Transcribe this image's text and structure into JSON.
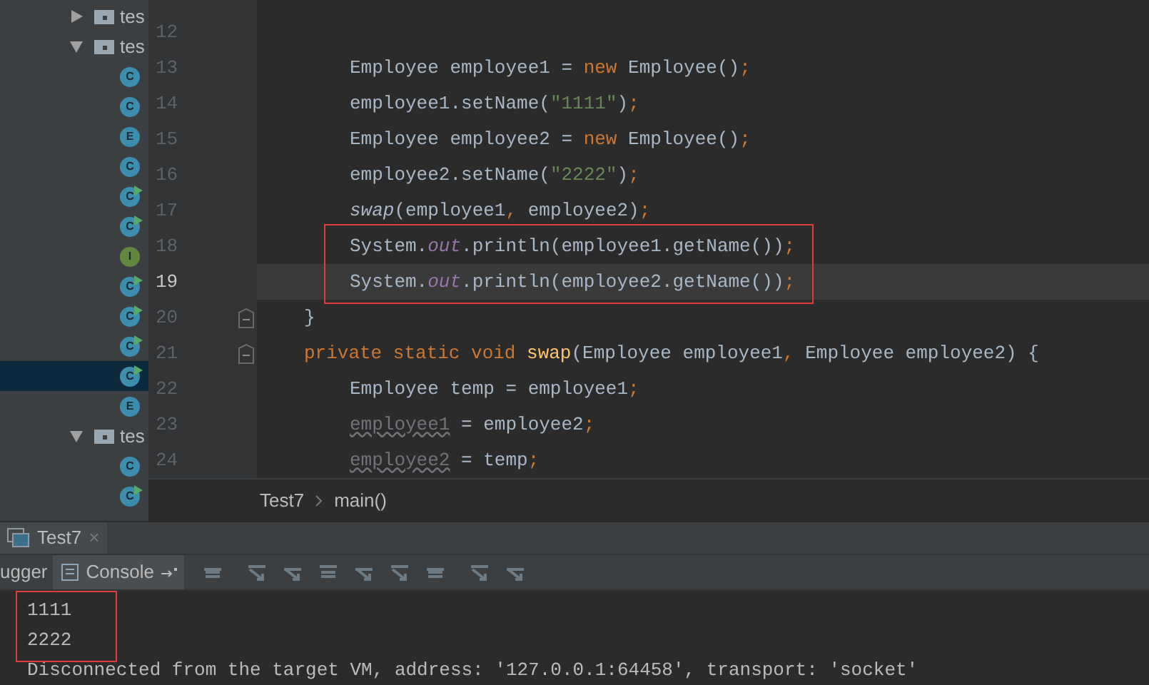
{
  "project_tree": [
    {
      "kind": "folder",
      "label": "tes",
      "expanded": false,
      "selected": false
    },
    {
      "kind": "folder",
      "label": "tes",
      "expanded": true,
      "selected": false,
      "children": [
        {
          "kind": "class",
          "letter": "C",
          "runnable": false,
          "selected": false
        },
        {
          "kind": "class",
          "letter": "C",
          "runnable": false,
          "selected": false
        },
        {
          "kind": "enum",
          "letter": "E",
          "runnable": false,
          "selected": false
        },
        {
          "kind": "class",
          "letter": "C",
          "runnable": false,
          "selected": false
        },
        {
          "kind": "class",
          "letter": "C",
          "runnable": true,
          "selected": false
        },
        {
          "kind": "class",
          "letter": "C",
          "runnable": true,
          "selected": false
        },
        {
          "kind": "interface",
          "letter": "I",
          "runnable": false,
          "selected": false
        },
        {
          "kind": "class",
          "letter": "C",
          "runnable": true,
          "selected": false
        },
        {
          "kind": "class",
          "letter": "C",
          "runnable": true,
          "selected": false
        },
        {
          "kind": "class",
          "letter": "C",
          "runnable": true,
          "selected": false
        },
        {
          "kind": "class",
          "letter": "C",
          "runnable": true,
          "selected": true
        },
        {
          "kind": "enum",
          "letter": "E",
          "runnable": false,
          "selected": false
        }
      ]
    },
    {
      "kind": "folder",
      "label": "tes",
      "expanded": true,
      "selected": false,
      "children": [
        {
          "kind": "class",
          "letter": "C",
          "runnable": false,
          "selected": false
        },
        {
          "kind": "class",
          "letter": "C",
          "runnable": true,
          "selected": false
        }
      ]
    }
  ],
  "editor": {
    "lines": [
      {
        "number": "12",
        "current": false,
        "boxed": false,
        "fold": false
      },
      {
        "number": "13",
        "current": false,
        "boxed": false,
        "fold": false,
        "tokens": [
          {
            "kind": "indent2"
          },
          {
            "kind": "plain",
            "text": "Employee employee1 = "
          },
          {
            "kind": "keyword",
            "text": "new"
          },
          {
            "kind": "plain",
            "text": " Employee()"
          },
          {
            "kind": "keyword",
            "text": ";"
          }
        ]
      },
      {
        "number": "14",
        "current": false,
        "boxed": false,
        "fold": false,
        "tokens": [
          {
            "kind": "indent2"
          },
          {
            "kind": "plain",
            "text": "employee1.setName("
          },
          {
            "kind": "string",
            "text": "\"1111\""
          },
          {
            "kind": "plain",
            "text": ")"
          },
          {
            "kind": "keyword",
            "text": ";"
          }
        ]
      },
      {
        "number": "15",
        "current": false,
        "boxed": false,
        "fold": false,
        "tokens": [
          {
            "kind": "indent2"
          },
          {
            "kind": "plain",
            "text": "Employee employee2 = "
          },
          {
            "kind": "keyword",
            "text": "new"
          },
          {
            "kind": "plain",
            "text": " Employee()"
          },
          {
            "kind": "keyword",
            "text": ";"
          }
        ]
      },
      {
        "number": "16",
        "current": false,
        "boxed": false,
        "fold": false,
        "tokens": [
          {
            "kind": "indent2"
          },
          {
            "kind": "plain",
            "text": "employee2.setName("
          },
          {
            "kind": "string",
            "text": "\"2222\""
          },
          {
            "kind": "plain",
            "text": ")"
          },
          {
            "kind": "keyword",
            "text": ";"
          }
        ]
      },
      {
        "number": "17",
        "current": false,
        "boxed": false,
        "fold": false,
        "tokens": [
          {
            "kind": "indent2"
          },
          {
            "kind": "static_call",
            "text": "swap"
          },
          {
            "kind": "plain",
            "text": "(employee1"
          },
          {
            "kind": "keyword",
            "text": ","
          },
          {
            "kind": "plain",
            "text": " employee2)"
          },
          {
            "kind": "keyword",
            "text": ";"
          }
        ]
      },
      {
        "number": "18",
        "current": false,
        "boxed": true,
        "fold": false,
        "tokens": [
          {
            "kind": "indent2"
          },
          {
            "kind": "plain",
            "text": "System."
          },
          {
            "kind": "field",
            "text": "out"
          },
          {
            "kind": "plain",
            "text": ".println(employee1.getName())"
          },
          {
            "kind": "keyword",
            "text": ";"
          }
        ]
      },
      {
        "number": "19",
        "current": true,
        "boxed": true,
        "fold": false,
        "tokens": [
          {
            "kind": "indent2"
          },
          {
            "kind": "plain",
            "text": "System."
          },
          {
            "kind": "field",
            "text": "out"
          },
          {
            "kind": "plain",
            "text": ".println(employee2.getName())"
          },
          {
            "kind": "keyword",
            "text": ";"
          }
        ]
      },
      {
        "number": "20",
        "current": false,
        "boxed": false,
        "fold": true,
        "tokens": [
          {
            "kind": "indent1"
          },
          {
            "kind": "plain",
            "text": "}"
          }
        ]
      },
      {
        "number": "21",
        "current": false,
        "boxed": false,
        "fold": true,
        "tokens": [
          {
            "kind": "indent1"
          },
          {
            "kind": "keyword",
            "text": "private static void "
          },
          {
            "kind": "method",
            "text": "swap"
          },
          {
            "kind": "plain",
            "text": "(Employee employee1"
          },
          {
            "kind": "keyword",
            "text": ","
          },
          {
            "kind": "plain",
            "text": " Employee employee2) {"
          }
        ]
      },
      {
        "number": "22",
        "current": false,
        "boxed": false,
        "fold": false,
        "tokens": [
          {
            "kind": "indent2"
          },
          {
            "kind": "plain",
            "text": "Employee temp = employee1"
          },
          {
            "kind": "keyword",
            "text": ";"
          }
        ]
      },
      {
        "number": "23",
        "current": false,
        "boxed": false,
        "fold": false,
        "tokens": [
          {
            "kind": "indent2"
          },
          {
            "kind": "unused",
            "text": "employee1"
          },
          {
            "kind": "plain",
            "text": " = employee2"
          },
          {
            "kind": "keyword",
            "text": ";"
          }
        ]
      },
      {
        "number": "24",
        "current": false,
        "boxed": false,
        "fold": false,
        "tokens": [
          {
            "kind": "indent2"
          },
          {
            "kind": "unused",
            "text": "employee2"
          },
          {
            "kind": "plain",
            "text": " = temp"
          },
          {
            "kind": "keyword",
            "text": ";"
          }
        ]
      }
    ],
    "breadcrumbs": [
      "Test7",
      "main()"
    ]
  },
  "run_panel": {
    "tab": {
      "label": "Test7",
      "close": "×"
    },
    "toolbar_tabs": [
      {
        "label": "ugger",
        "selected": false
      },
      {
        "label": "Console",
        "selected": true
      }
    ],
    "console": {
      "lines": [
        {
          "text": "1111",
          "boxed": true
        },
        {
          "text": "2222",
          "boxed": true
        },
        {
          "text": "Disconnected from the target VM, address: '127.0.0.1:64458', transport: 'socket'",
          "boxed": false
        }
      ]
    }
  }
}
